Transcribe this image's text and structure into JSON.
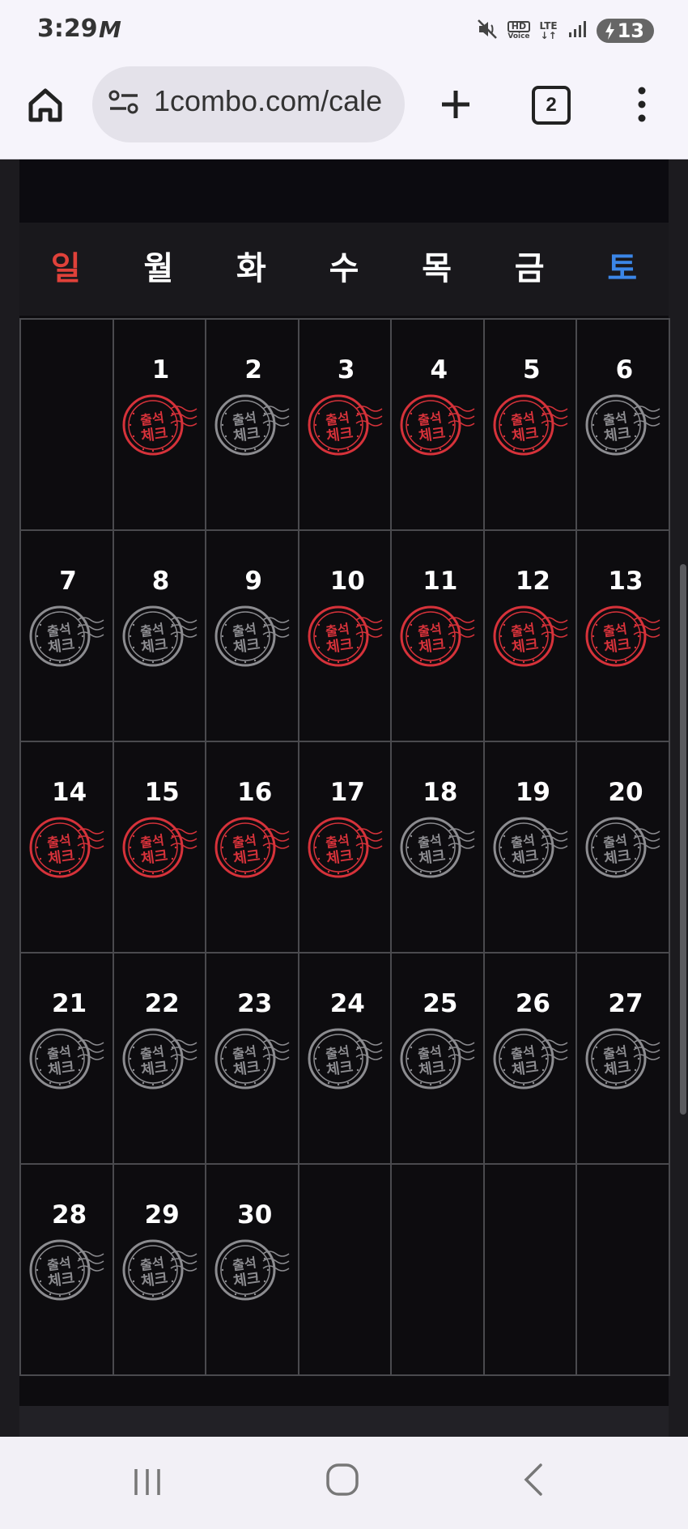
{
  "status_bar": {
    "time": "3:29",
    "carrier_glyph": "M",
    "hd_label": "HD",
    "hd_sub": "Voice",
    "lte_label": "LTE",
    "battery_level": "13",
    "icons": [
      "mute-icon",
      "hd-voice-icon",
      "lte-icon",
      "signal-icon",
      "battery-charging-icon"
    ]
  },
  "browser": {
    "url": "1combo.com/cale",
    "tab_count": "2",
    "icons": [
      "home-icon",
      "site-settings-icon",
      "new-tab-icon",
      "tab-switcher-icon",
      "more-menu-icon"
    ]
  },
  "calendar": {
    "weekdays": [
      {
        "label": "일",
        "color": "#e0413a"
      },
      {
        "label": "월",
        "color": "#ffffff"
      },
      {
        "label": "화",
        "color": "#ffffff"
      },
      {
        "label": "수",
        "color": "#ffffff"
      },
      {
        "label": "목",
        "color": "#ffffff"
      },
      {
        "label": "금",
        "color": "#ffffff"
      },
      {
        "label": "토",
        "color": "#3b86e8"
      }
    ],
    "stamp_text_top": "출석",
    "stamp_text_bottom": "체크",
    "attended_color": "#d6323a",
    "not_attended_color": "#8c8c90",
    "days": [
      {
        "day": ""
      },
      {
        "day": "1",
        "attended": true
      },
      {
        "day": "2",
        "attended": false
      },
      {
        "day": "3",
        "attended": true
      },
      {
        "day": "4",
        "attended": true
      },
      {
        "day": "5",
        "attended": true
      },
      {
        "day": "6",
        "attended": false
      },
      {
        "day": "7",
        "attended": false
      },
      {
        "day": "8",
        "attended": false
      },
      {
        "day": "9",
        "attended": false
      },
      {
        "day": "10",
        "attended": true
      },
      {
        "day": "11",
        "attended": true
      },
      {
        "day": "12",
        "attended": true
      },
      {
        "day": "13",
        "attended": true
      },
      {
        "day": "14",
        "attended": true
      },
      {
        "day": "15",
        "attended": true
      },
      {
        "day": "16",
        "attended": true
      },
      {
        "day": "17",
        "attended": true
      },
      {
        "day": "18",
        "attended": false
      },
      {
        "day": "19",
        "attended": false
      },
      {
        "day": "20",
        "attended": false
      },
      {
        "day": "21",
        "attended": false
      },
      {
        "day": "22",
        "attended": false
      },
      {
        "day": "23",
        "attended": false
      },
      {
        "day": "24",
        "attended": false
      },
      {
        "day": "25",
        "attended": false
      },
      {
        "day": "26",
        "attended": false
      },
      {
        "day": "27",
        "attended": false
      },
      {
        "day": "28",
        "attended": false
      },
      {
        "day": "29",
        "attended": false
      },
      {
        "day": "30",
        "attended": false
      },
      {
        "day": ""
      },
      {
        "day": ""
      },
      {
        "day": ""
      },
      {
        "day": ""
      }
    ]
  },
  "nav_bar": {
    "icons": [
      "recent-apps-icon",
      "home-icon",
      "back-icon"
    ]
  }
}
